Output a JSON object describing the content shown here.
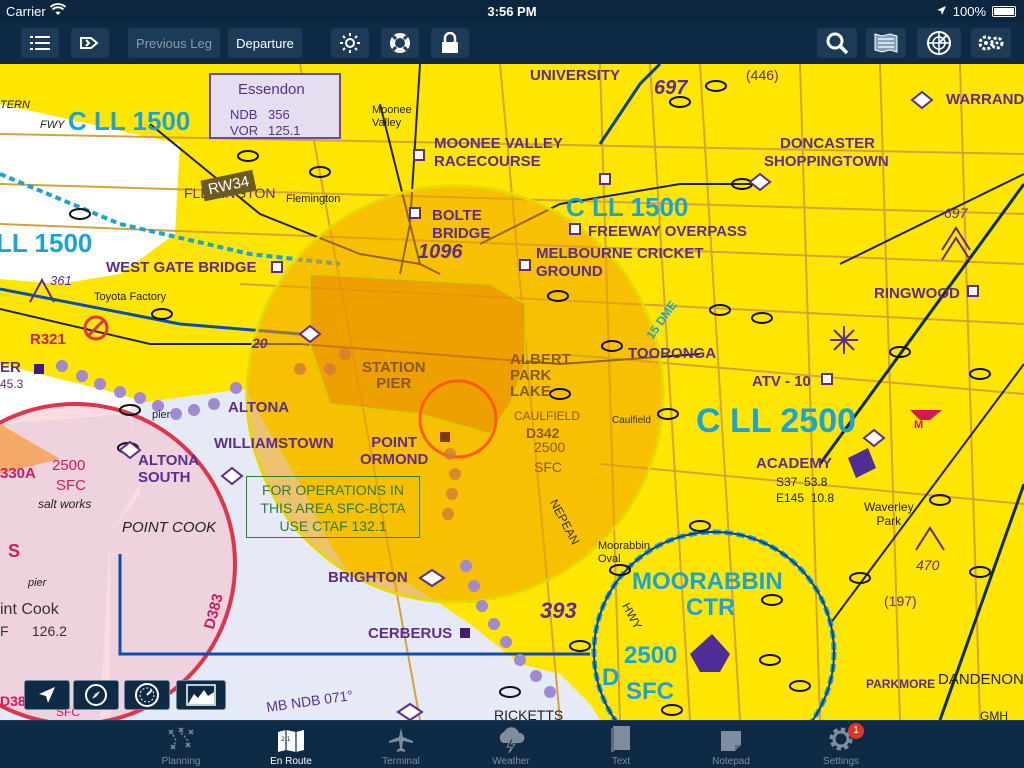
{
  "status_bar": {
    "carrier": "Carrier",
    "time": "3:56 PM",
    "battery": "100%"
  },
  "toolbar": {
    "previous_leg": "Previous Leg",
    "departure": "Departure"
  },
  "map": {
    "labels": {
      "essendon": "Essendon",
      "ndb": "NDB",
      "ndb_freq": "356",
      "vor": "VOR",
      "vor_freq": "125.1",
      "cll1500_nw": "C LL 1500",
      "cll1500_w": "LL 1500",
      "cll1500_ne": "C LL 1500",
      "cll2500": "C LL 2500",
      "rw34": "RW34",
      "flemington": "FLEMINGTON",
      "flemington_small": "Flemington",
      "moonee_valley": "Moonee\nValley",
      "moonee_valley_rc": "MOONEE VALLEY",
      "racecourse": "RACECOURSE",
      "bolte": "BOLTE",
      "bridge": "BRIDGE",
      "alt_1096": "1096",
      "freeway_overpass": "FREEWAY OVERPASS",
      "melbourne_cricket": "MELBOURNE CRICKET",
      "ground": "GROUND",
      "university": "UNIVERSITY",
      "alt_697_top": "697",
      "alt_446": "(446)",
      "warrand": "WARRAND",
      "doncaster": "DONCASTER",
      "shoppingtown": "SHOPPINGTOWN",
      "alt_697_right": "697",
      "west_gate_bridge": "WEST GATE BRIDGE",
      "alt_361": "361",
      "toyota_factory": "Toyota Factory",
      "r321": "R321",
      "er": "ER",
      "alt_453": "45.3",
      "ringwood": "RINGWOOD",
      "dme": "15 DME",
      "tooronga": "TOORONGA",
      "atv10": "ATV - 10",
      "station_pier": "STATION\nPIER",
      "albert_park_lake": "ALBERT\nPARK\nLAKE",
      "caulfield": "CAULFIELD",
      "caulfield_small": "Caulfield",
      "altona": "ALTONA",
      "williamstown": "WILLIAMSTOWN",
      "point_ormond": "POINT\nORMOND",
      "d342": "D342",
      "alt_2500_a": "2500",
      "sfc_a": "SFC",
      "academy": "ACADEMY",
      "s37": "S37  53.8",
      "e145": "E145  10.8",
      "waverley": "Waverley\nPark",
      "m_marker": "M",
      "altona_south": "ALTONA\nSOUTH",
      "pier_small": "pier",
      "r330a": "330A",
      "alt_2500_b": "2500",
      "sfc_b": "SFC",
      "salt_works": "salt works",
      "point_cook": "POINT COOK",
      "pier_small2": "pier",
      "int_cook": "int Cook",
      "f_freq": "F      126.2",
      "ops_box": "FOR OPERATIONS IN\nTHIS AREA SFC-BCTA\nUSE CTAF 132.1",
      "nepean": "NEPEAN",
      "moorabbin_oval": "Moorabbin\nOval",
      "moorabbin": "MOORABBIN",
      "ctr": "CTR",
      "d_label": "D",
      "alt_2500_c": "2500",
      "sfc_c": "SFC",
      "alt_470": "470",
      "alt_197": "(197)",
      "brighton": "BRIGHTON",
      "d383": "D383",
      "alt_393": "393",
      "cerberus": "CERBERUS",
      "hwy": "HWY",
      "mb_ndb": "MB NDB 071°",
      "ricketts": "RICKETTS",
      "d38": "D38",
      "sfc_d": "SFC",
      "parkmore": "PARKMORE",
      "dandenon": "DANDENON",
      "gmh": "GMH",
      "fwy": "FWY",
      "tern": "TERN",
      "s_mark": "S",
      "alt_20": "20"
    }
  },
  "tabs": [
    {
      "label": "Planning",
      "icon": "planning-icon"
    },
    {
      "label": "En Route",
      "icon": "map-icon"
    },
    {
      "label": "Terminal",
      "icon": "airplane-icon"
    },
    {
      "label": "Weather",
      "icon": "weather-icon"
    },
    {
      "label": "Text",
      "icon": "book-icon"
    },
    {
      "label": "Notepad",
      "icon": "notepad-icon"
    },
    {
      "label": "Settings",
      "icon": "gear-icon",
      "badge": "1"
    }
  ],
  "colors": {
    "map_yellow": "#ffe600",
    "water": "#e6eaf6",
    "airspace_blue": "#1aa3d9",
    "orange_circle": "#f0a000"
  }
}
